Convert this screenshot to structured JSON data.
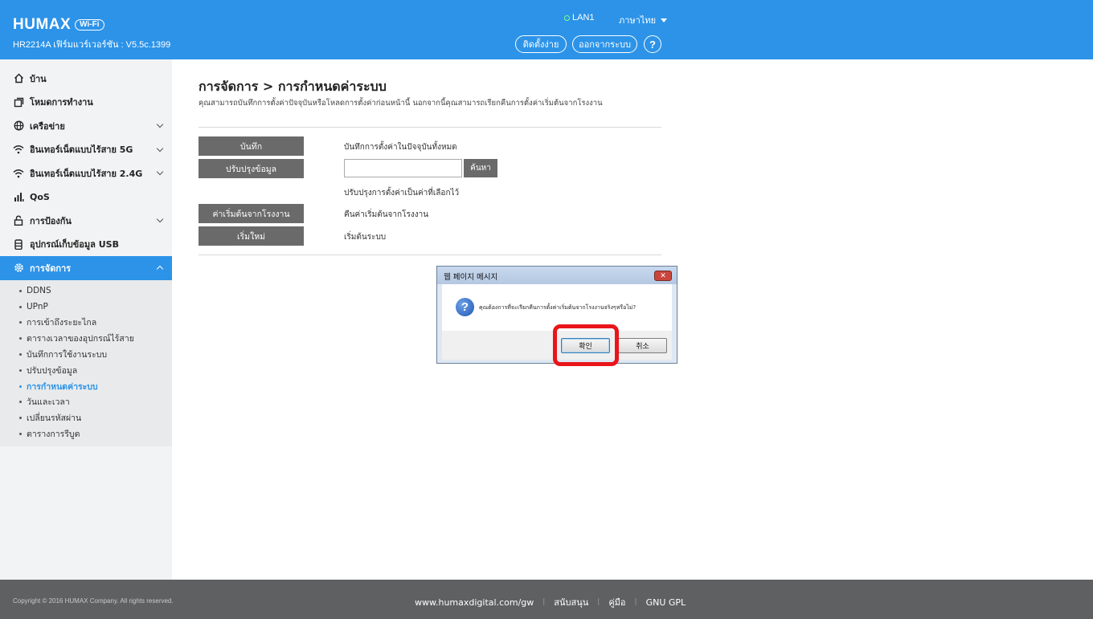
{
  "header": {
    "logo": "HUMAX",
    "wifi_badge": "Wi-Fi",
    "firmware": "HR2214A เฟิร์มแวร์เวอร์ชัน : V5.5c.1399",
    "lan_status": "LAN1",
    "language": "ภาษาไทย",
    "setup_button": "ติดตั้งง่าย",
    "logout_button": "ออกจากระบบ",
    "help_button": "?"
  },
  "sidebar": {
    "items": [
      {
        "label": "บ้าน",
        "icon": "home-icon"
      },
      {
        "label": "โหมดการทำงาน",
        "icon": "mode-icon"
      },
      {
        "label": "เครือข่าย",
        "icon": "globe-icon"
      },
      {
        "label": "อินเทอร์เน็ตแบบไร้สาย 5G",
        "icon": "wifi-icon"
      },
      {
        "label": "อินเทอร์เน็ตแบบไร้สาย 2.4G",
        "icon": "wifi-icon"
      },
      {
        "label": "QoS",
        "icon": "bars-icon"
      },
      {
        "label": "การป้องกัน",
        "icon": "lock-icon"
      },
      {
        "label": "อุปกรณ์เก็บข้อมูล USB",
        "icon": "usb-icon"
      },
      {
        "label": "การจัดการ",
        "icon": "gear-icon"
      }
    ],
    "submenu": [
      "DDNS",
      "UPnP",
      "การเข้าถึงระยะไกล",
      "ตารางเวลาของอุปกรณ์ไร้สาย",
      "บันทึกการใช้งานระบบ",
      "ปรับปรุงข้อมูล",
      "การกำหนดค่าระบบ",
      "วันและเวลา",
      "เปลี่ยนรหัสผ่าน",
      "ตารางการรีบูต"
    ]
  },
  "main": {
    "title": "การจัดการ > การกำหนดค่าระบบ",
    "description": "คุณสามารถบันทึกการตั้งค่าปัจจุบันหรือโหลดการตั้งค่าก่อนหน้านี้ นอกจากนี้คุณสามารถเรียกคืนการตั้งค่าเริ่มต้นจากโรงงาน",
    "save_button": "บันทึก",
    "save_desc": "บันทึกการตั้งค่าในปัจจุบันทั้งหมด",
    "update_button": "ปรับปรุงข้อมูล",
    "file_value": "",
    "search_button": "ค้นหา",
    "update_desc": "ปรับปรุงการตั้งค่าเป็นค่าที่เลือกไว้",
    "factory_button": "ค่าเริ่มต้นจากโรงงาน",
    "factory_desc": "คืนค่าเริ่มต้นจากโรงงาน",
    "restart_button": "เริ่มใหม่",
    "restart_desc": "เริ่มต้นระบบ"
  },
  "dialog": {
    "title": "웹 페이지 메시지",
    "close": "✕",
    "question_mark": "?",
    "message": "คุณต้องการที่จะเรียกคืนการตั้งค่าเริ่มต้นจากโรงงานจริงๆหรือไม่?",
    "ok_button": "확인",
    "cancel_button": "취소",
    "highlight_color": "#e8151b"
  },
  "footer": {
    "copyright": "Copyright © 2016 HUMAX Company. All rights reserved.",
    "links": [
      "www.humaxdigital.com/gw",
      "สนับสนุน",
      "คู่มือ",
      "GNU GPL"
    ]
  },
  "colors": {
    "header_blue": "#2c93e8",
    "sidebar_bg": "#f2f3f4",
    "button_gray": "#6a6a6a",
    "footer_bg": "#5f6062"
  }
}
